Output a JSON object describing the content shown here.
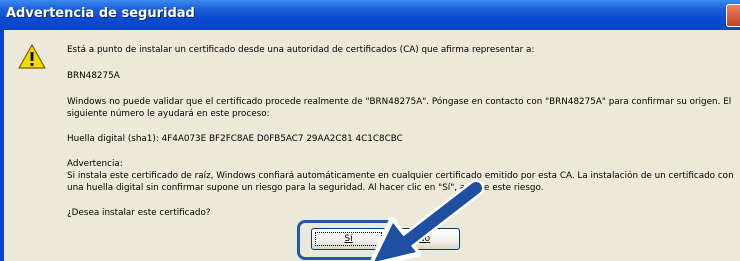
{
  "window": {
    "title": "Advertencia de seguridad"
  },
  "message": {
    "intro": "Está a punto de instalar un certificado desde una autoridad de certificados (CA) que afirma representar a:",
    "ca_name": "BRN48275A",
    "validate_line1": "Windows no puede validar que el certificado procede realmente de \"BRN48275A\". Póngase en contacto con \"BRN48275A\" para confirmar su origen. El",
    "validate_line2": "siguiente número le ayudará en este proceso:",
    "thumbprint": "Huella digital (sha1): 4F4A073E BF2FC8AE D0FB5AC7 29AA2C81 4C1C8CBC",
    "warning_heading": "Advertencia:",
    "warning_line1": "Si instala este certificado de raíz, Windows confiará automáticamente en cualquier certificado emitido por esta CA. La instalación de un certificado con",
    "warning_line2": "una huella digital sin confirmar supone un riesgo para la seguridad. Al hacer clic en \"Sí\", asume este riesgo.",
    "question": "¿Desea instalar este certificado?"
  },
  "buttons": {
    "yes": "Sí",
    "no": "No"
  },
  "icons": {
    "warning": "warning-icon",
    "pointer_arrow": "arrow-icon"
  },
  "colors": {
    "titlebar": "#0a46c4",
    "dialog_bg": "#ece9d8",
    "highlight": "#1f5ba8",
    "arrow": "#1f4fa0"
  }
}
